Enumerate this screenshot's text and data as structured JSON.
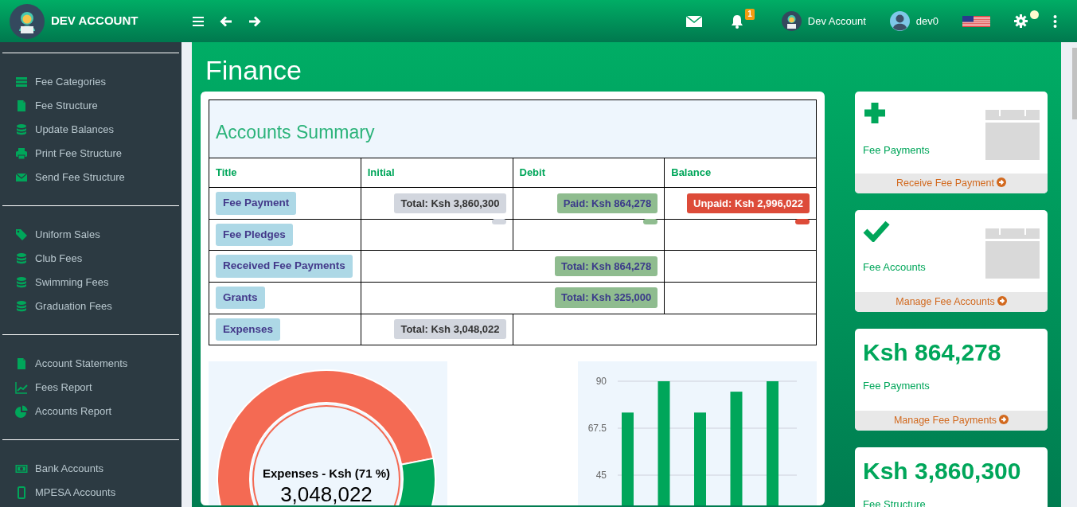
{
  "header": {
    "brand": "DEV ACCOUNT",
    "notification_count": "1",
    "account_name": "Dev Account",
    "user_name": "dev0"
  },
  "sidebar": {
    "groups": [
      {
        "items": [
          {
            "label": "Fee Categories",
            "kind": "list"
          },
          {
            "label": "Fee Structure",
            "kind": "file"
          },
          {
            "label": "Update Balances",
            "kind": "database"
          },
          {
            "label": "Print Fee Structure",
            "kind": "print"
          },
          {
            "label": "Send Fee Structure",
            "kind": "mail"
          }
        ]
      },
      {
        "items": [
          {
            "label": "Uniform Sales",
            "kind": "tag"
          },
          {
            "label": "Club Fees",
            "kind": "database"
          },
          {
            "label": "Swimming Fees",
            "kind": "database"
          },
          {
            "label": "Graduation Fees",
            "kind": "database"
          }
        ]
      },
      {
        "items": [
          {
            "label": "Account Statements",
            "kind": "file"
          },
          {
            "label": "Fees Report",
            "kind": "chart"
          },
          {
            "label": "Accounts Report",
            "kind": "pie"
          }
        ]
      },
      {
        "items": [
          {
            "label": "Bank Accounts",
            "kind": "money"
          },
          {
            "label": "MPESA Accounts",
            "kind": "phone"
          }
        ]
      }
    ]
  },
  "page_title": "Finance",
  "summary": {
    "title": "Accounts Summary",
    "columns": [
      "Title",
      "Initial",
      "Debit",
      "Balance"
    ],
    "rows": [
      {
        "cells": [
          {
            "kind": "title",
            "text": "Fee Payment"
          },
          {
            "kind": "amount",
            "text": "Total: Ksh 3,860,300",
            "color": "#d2d6de"
          },
          {
            "kind": "amount",
            "text": "Paid: Ksh 864,278",
            "color": "#8fbc8f"
          },
          {
            "kind": "amount",
            "text": "Unpaid: Ksh 2,996,022",
            "color": "#dd4b39"
          }
        ]
      },
      {
        "cells": [
          {
            "kind": "title",
            "text": "Fee Pledges"
          },
          {
            "kind": "amount",
            "color": "#d2d6de"
          },
          {
            "kind": "amount",
            "color": "#8fbc8f"
          },
          {
            "kind": "amount",
            "color": "#dd4b39"
          }
        ]
      },
      {
        "cells": [
          {
            "kind": "title",
            "text": "Received Fee Payments"
          },
          {
            "kind": "amount",
            "text": "Total: Ksh 864,278",
            "color": "#8fbc8f",
            "colspan": 2
          },
          {
            "kind": "empty"
          }
        ]
      },
      {
        "cells": [
          {
            "kind": "title",
            "text": "Grants"
          },
          {
            "kind": "amount",
            "text": "Total: Ksh 325,000",
            "color": "#8fbc8f",
            "colspan": 2
          },
          {
            "kind": "empty"
          }
        ]
      },
      {
        "cells": [
          {
            "kind": "title",
            "text": "Expenses"
          },
          {
            "kind": "amount",
            "text": "Total: Ksh 3,048,022",
            "color": "#d2d6de"
          },
          {
            "kind": "empty",
            "colspan": 2
          }
        ]
      }
    ]
  },
  "donut": {
    "center_label": "Expenses - Ksh (71 %)",
    "center_value": "3,048,022",
    "chart_data": {
      "type": "donut",
      "values": [
        71,
        29
      ]
    }
  },
  "bars": {
    "chart_data": {
      "type": "bar",
      "ylim": [
        0,
        90
      ],
      "yticks": [
        45,
        67.5,
        90
      ],
      "series": [
        {
          "color": "#00a65a",
          "values": [
            75,
            90,
            75,
            85,
            90
          ]
        }
      ]
    }
  },
  "tiles": [
    {
      "kind": "plus",
      "caption": "Fee Payments",
      "link": "Receive Fee Payment"
    },
    {
      "kind": "tick",
      "caption": "Fee Accounts",
      "link": "Manage Fee Accounts"
    },
    {
      "kind": "amount",
      "amount": "Ksh 864,278",
      "caption": "Fee Payments",
      "link": "Manage Fee Payments"
    },
    {
      "kind": "amount",
      "amount": "Ksh 3,860,300",
      "caption": "Fee Structure"
    }
  ]
}
